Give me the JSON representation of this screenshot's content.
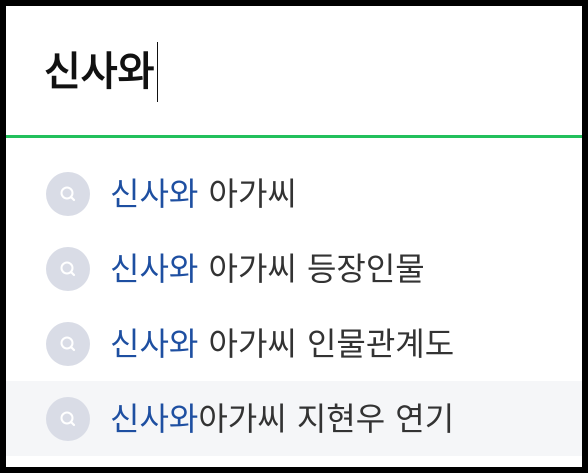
{
  "search": {
    "query": "신사와"
  },
  "suggestions": [
    {
      "keyword": "신사와",
      "rest": " 아가씨"
    },
    {
      "keyword": "신사와",
      "rest": " 아가씨 등장인물"
    },
    {
      "keyword": "신사와",
      "rest": " 아가씨 인물관계도"
    },
    {
      "keyword": "신사와",
      "rest": "아가씨 지현우 연기"
    }
  ],
  "colors": {
    "accent_line": "#22c05c",
    "keyword": "#1e4fa1",
    "icon_bg": "#d9dce6"
  },
  "icons": {
    "suggestion": "search-icon"
  }
}
